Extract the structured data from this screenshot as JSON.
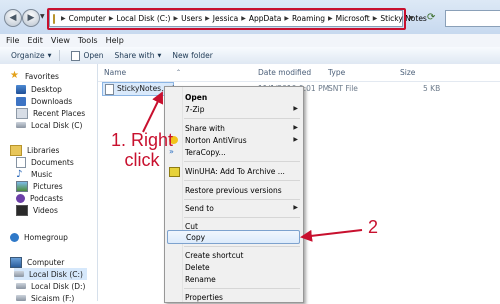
{
  "address_bar": {
    "path": [
      "Computer",
      "Local Disk (C:)",
      "Users",
      "Jessica",
      "AppData",
      "Roaming",
      "Microsoft",
      "Sticky Notes"
    ],
    "highlight_color": "#c8102e"
  },
  "menu": [
    "File",
    "Edit",
    "View",
    "Tools",
    "Help"
  ],
  "toolbar": {
    "organize": "Organize",
    "open": "Open",
    "share_with": "Share with",
    "new_folder": "New folder"
  },
  "nav": {
    "favorites": "Favorites",
    "favorites_items": [
      "Desktop",
      "Downloads",
      "Recent Places",
      "Local Disk (C)"
    ],
    "libraries": "Libraries",
    "libraries_items": [
      "Documents",
      "Music",
      "Pictures",
      "Podcasts",
      "Videos"
    ],
    "homegroup": "Homegroup",
    "computer": "Computer",
    "computer_items": [
      "Local Disk (C:)",
      "Local Disk (D:)",
      "Sicaism (F:)"
    ]
  },
  "columns": {
    "name": "Name",
    "date_modified": "Date modified",
    "type": "Type",
    "size": "Size"
  },
  "file": {
    "name": "StickyNotes.snt",
    "date": "11/1/2010 9:01 PM",
    "type": "SNT File",
    "size": "5 KB"
  },
  "context_menu": {
    "open": "Open",
    "zip": "7-Zip",
    "share_with": "Share with",
    "norton": "Norton AntiVirus",
    "teracopy": "TeraCopy...",
    "winuha": "WinUHA: Add To Archive ...",
    "restore": "Restore previous versions",
    "send_to": "Send to",
    "cut": "Cut",
    "copy": "Copy",
    "create_shortcut": "Create shortcut",
    "delete": "Delete",
    "rename": "Rename",
    "properties": "Properties"
  },
  "annotations": {
    "step1_line1": "1. Right",
    "step1_line2": "click",
    "step2": "2",
    "color": "#c8102e"
  }
}
